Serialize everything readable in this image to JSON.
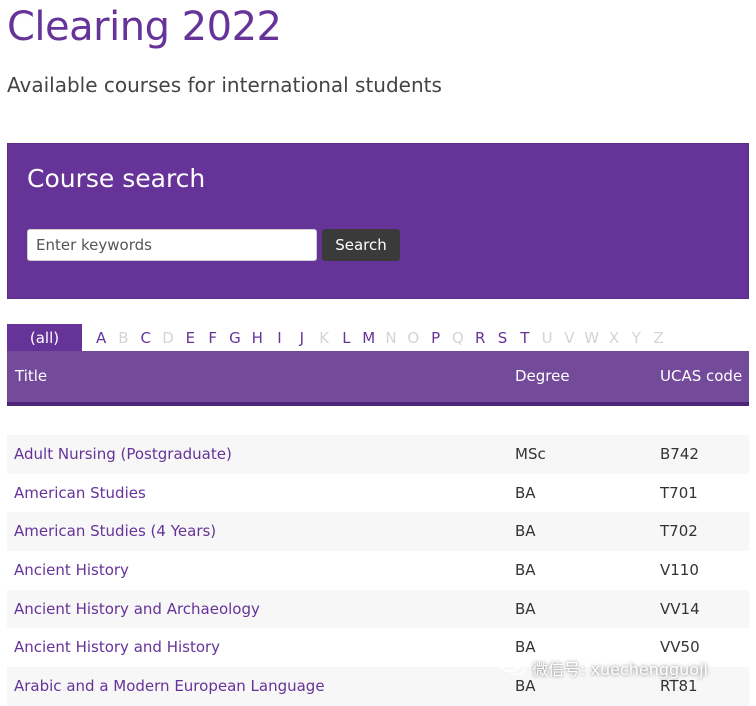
{
  "page": {
    "title": "Clearing 2022",
    "subtitle": "Available courses for international students"
  },
  "search": {
    "heading": "Course search",
    "placeholder": "Enter keywords",
    "button_label": "Search"
  },
  "alphabet": {
    "all_label": "(all)",
    "letters": [
      {
        "l": "A",
        "enabled": true
      },
      {
        "l": "B",
        "enabled": false
      },
      {
        "l": "C",
        "enabled": true
      },
      {
        "l": "D",
        "enabled": false
      },
      {
        "l": "E",
        "enabled": true
      },
      {
        "l": "F",
        "enabled": true
      },
      {
        "l": "G",
        "enabled": true
      },
      {
        "l": "H",
        "enabled": true
      },
      {
        "l": "I",
        "enabled": true
      },
      {
        "l": "J",
        "enabled": true
      },
      {
        "l": "K",
        "enabled": false
      },
      {
        "l": "L",
        "enabled": true
      },
      {
        "l": "M",
        "enabled": true
      },
      {
        "l": "N",
        "enabled": false
      },
      {
        "l": "O",
        "enabled": false
      },
      {
        "l": "P",
        "enabled": true
      },
      {
        "l": "Q",
        "enabled": false
      },
      {
        "l": "R",
        "enabled": true
      },
      {
        "l": "S",
        "enabled": true
      },
      {
        "l": "T",
        "enabled": true
      },
      {
        "l": "U",
        "enabled": false
      },
      {
        "l": "V",
        "enabled": false
      },
      {
        "l": "W",
        "enabled": false
      },
      {
        "l": "X",
        "enabled": false
      },
      {
        "l": "Y",
        "enabled": false
      },
      {
        "l": "Z",
        "enabled": false
      }
    ]
  },
  "table": {
    "headers": {
      "title": "Title",
      "degree": "Degree",
      "ucas": "UCAS code"
    },
    "rows": [
      {
        "title": "Adult Nursing (Postgraduate)",
        "degree": "MSc",
        "ucas": "B742"
      },
      {
        "title": "American Studies",
        "degree": "BA",
        "ucas": "T701"
      },
      {
        "title": "American Studies (4 Years)",
        "degree": "BA",
        "ucas": "T702"
      },
      {
        "title": "Ancient History",
        "degree": "BA",
        "ucas": "V110"
      },
      {
        "title": "Ancient History and Archaeology",
        "degree": "BA",
        "ucas": "VV14"
      },
      {
        "title": "Ancient History and History",
        "degree": "BA",
        "ucas": "VV50"
      },
      {
        "title": "Arabic and a Modern European Language",
        "degree": "BA",
        "ucas": "RT81"
      }
    ]
  },
  "watermark": {
    "icon": "wechat-icon",
    "text": "微信号: xuechengguoji"
  },
  "colors": {
    "brand_purple": "#663399",
    "header_purple": "#744a9a",
    "button_dark": "#3a3a3a"
  }
}
